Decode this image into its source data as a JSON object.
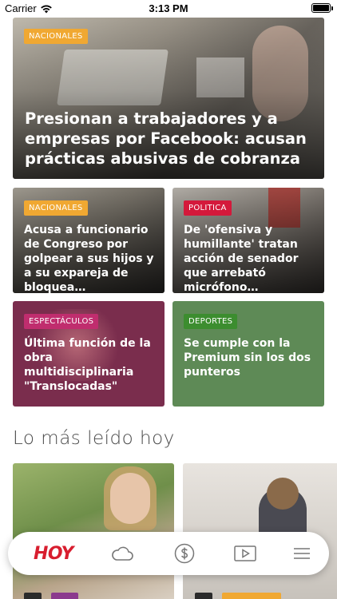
{
  "status_bar": {
    "carrier": "Carrier",
    "time": "3:13 PM"
  },
  "hero": {
    "tag": "NACIONALES",
    "headline": "Presionan a trabajadores y a empresas por Facebook: acusan prácticas abusivas de cobranza"
  },
  "cards": [
    {
      "tag": "NACIONALES",
      "headline": "Acusa a funcionario de Congreso por golpear a sus hijos y a su expareja de bloquea…"
    },
    {
      "tag": "POLITICA",
      "headline": "De 'ofensiva y humillante' tratan acción de senador que arrebató  micrófono…"
    },
    {
      "tag": "ESPECTÁCULOS",
      "headline": "Última función de la obra multidisciplinaria \"Translocadas\""
    },
    {
      "tag": "DEPORTES",
      "headline": "Se cumple con la Premium sin los dos punteros"
    }
  ],
  "section": {
    "title": "Lo más leído hoy"
  },
  "nav": {
    "logo": "HOY",
    "items": [
      {
        "icon": "cloud-icon"
      },
      {
        "icon": "dollar-icon"
      },
      {
        "icon": "play-icon"
      },
      {
        "icon": "menu-icon"
      }
    ]
  },
  "colors": {
    "nacionales": "#f0a832",
    "politica": "#d4193b",
    "espectaculos": "#c02d6e",
    "deportes": "#3c8d2f",
    "brand": "#d81e2f"
  }
}
